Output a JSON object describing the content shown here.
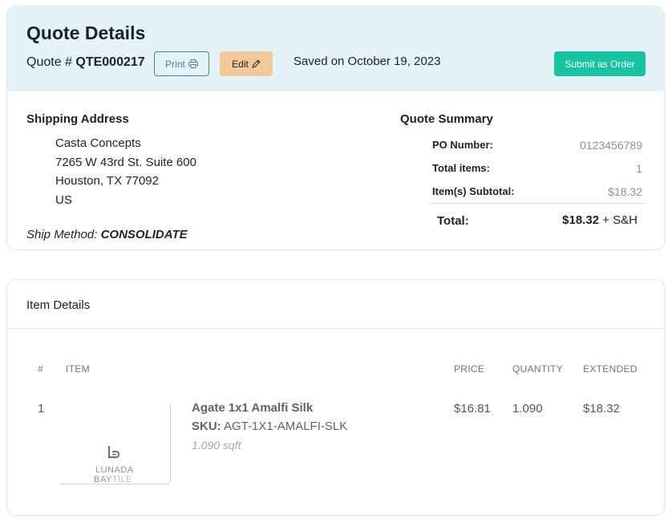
{
  "header": {
    "title": "Quote Details",
    "quote_prefix": "Quote #",
    "quote_number": "QTE000217",
    "print_label": "Print",
    "edit_label": "Edit",
    "saved_text": "Saved on October 19, 2023",
    "submit_label": "Submit as Order"
  },
  "shipping": {
    "heading": "Shipping Address",
    "lines": [
      "Casta Concepts",
      "7265 W 43rd St. Suite 600",
      "Houston, TX 77092",
      "US"
    ],
    "method_label": "Ship Method:",
    "method_value": "CONSOLIDATE"
  },
  "summary": {
    "heading": "Quote Summary",
    "rows": [
      {
        "label": "PO Number:",
        "value": "0123456789"
      },
      {
        "label": "Total items:",
        "value": "1"
      },
      {
        "label": "Item(s) Subtotal:",
        "value": "$18.32"
      }
    ],
    "total_label": "Total:",
    "total_value": "$18.32",
    "total_suffix": "+ S&H"
  },
  "items": {
    "heading": "Item Details",
    "columns": [
      "#",
      "ITEM",
      "PRICE",
      "QUANTITY",
      "EXTENDED"
    ],
    "rows": [
      {
        "index": "1",
        "name": "Agate 1x1 Amalfi Silk",
        "sku_label": "SKU:",
        "sku": "AGT-1X1-AMALFI-SLK",
        "sqft": "1.090 sqft",
        "price": "$16.81",
        "quantity": "1.090",
        "extended": "$18.32",
        "logo_line1": "LUNADA",
        "logo_line2a": "BAY",
        "logo_line2b": "TILE"
      }
    ]
  },
  "colors": {
    "header_bg": "#e3f3f8",
    "print_blue": "#3b82c4",
    "edit_orange": "#f3c89a",
    "submit_teal": "#18c4a0"
  },
  "icons": {
    "print": "printer-icon",
    "edit": "pencil-icon",
    "logo": "lunada-bay-logo-icon"
  }
}
